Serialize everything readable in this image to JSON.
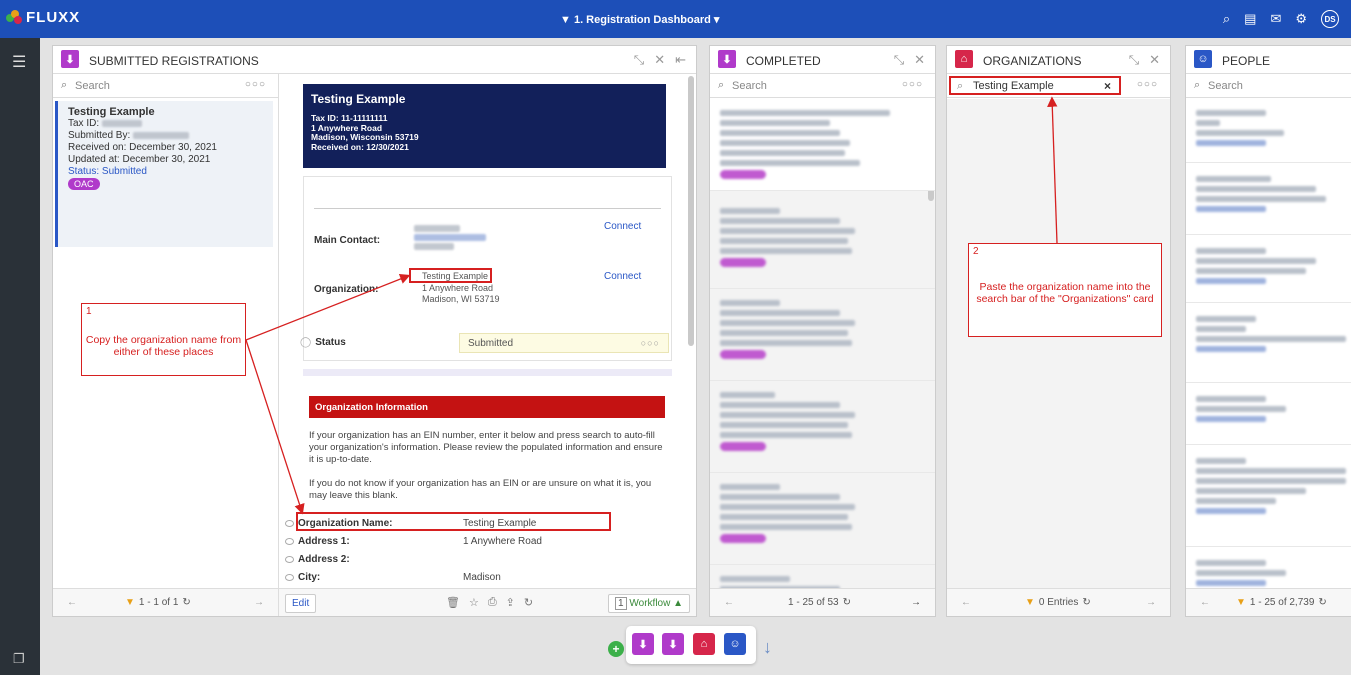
{
  "app": {
    "brand": "FLUXX",
    "dashboard": "1. Registration Dashboard ▾",
    "user_initials": "DS"
  },
  "colors": {
    "topbar": "#1d4fb8",
    "registrations": "#b03aca",
    "completed": "#b03aca",
    "organizations": "#d6264a",
    "people": "#2a57c6",
    "annotation": "#d62020"
  },
  "cards": {
    "submitted": {
      "title": "SUBMITTED REGISTRATIONS",
      "search_placeholder": "Search",
      "item": {
        "name": "Testing Example",
        "tax_label": "Tax ID:",
        "submitted_by_label": "Submitted By:",
        "received": "Received on: December 30, 2021",
        "updated": "Updated at: December 30, 2021",
        "status": "Status: Submitted",
        "badge": "OAC"
      },
      "paging": "1 - 1 of 1"
    },
    "detail": {
      "header_title": "Testing Example",
      "header_lines": [
        "Tax ID: 11-11111111",
        "1 Anywhere Road",
        "Madison, Wisconsin 53719",
        "Received on: 12/30/2021"
      ],
      "main_contact_label": "Main Contact:",
      "organization_label": "Organization:",
      "connect": "Connect",
      "org_name": "Testing Example",
      "org_addr1": "1 Anywhere Road",
      "org_addr2": "Madison, WI 53719",
      "status_label": "Status",
      "status_value": "Submitted",
      "section_title": "Organization Information",
      "para1": "If your organization has an EIN number, enter it below and press search to auto-fill your organization's information. Please review the populated information and ensure it is up-to-date.",
      "para2": "If you do not know if your organization has an EIN or are unsure on what it is, you may leave this blank.",
      "fields": [
        {
          "label": "Organization Name:",
          "value": "Testing Example"
        },
        {
          "label": "Address 1:",
          "value": "1 Anywhere Road"
        },
        {
          "label": "Address 2:",
          "value": ""
        },
        {
          "label": "City:",
          "value": "Madison"
        }
      ],
      "edit": "Edit",
      "workflow_count": "1",
      "workflow": "Workflow ▲"
    },
    "completed": {
      "title": "COMPLETED",
      "search_placeholder": "Search",
      "paging": "1 - 25 of 53"
    },
    "organizations": {
      "title": "ORGANIZATIONS",
      "search_value": "Testing Example",
      "paging": "0 Entries"
    },
    "people": {
      "title": "PEOPLE",
      "search_placeholder": "Search",
      "paging": "1 - 25 of 2,739"
    }
  },
  "annotations": {
    "step1_num": "1",
    "step1_text": "Copy the organization name from either of these places",
    "step2_num": "2",
    "step2_text": "Paste the organization name into the search bar of the \"Organizations\" card"
  }
}
